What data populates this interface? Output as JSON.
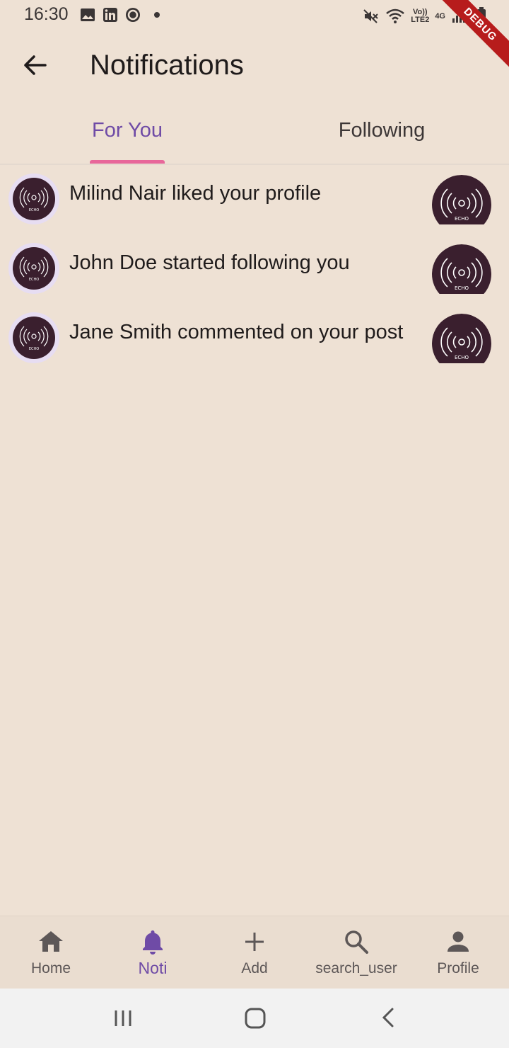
{
  "status_bar": {
    "time": "16:30",
    "icons_left": [
      "image-icon",
      "linkedin-icon",
      "record-icon",
      "dot-icon"
    ],
    "icons_right": [
      "mute-icon",
      "wifi-icon",
      "volte-icon",
      "signal-icon",
      "battery-icon"
    ],
    "volte_label_1": "Vo))",
    "volte_label_2": "LTE2",
    "network_label": "4G"
  },
  "debug_banner": "DEBUG",
  "app_bar": {
    "title": "Notifications",
    "back_icon": "arrow-left-icon"
  },
  "tabs": [
    {
      "label": "For You",
      "selected": true
    },
    {
      "label": "Following",
      "selected": false
    }
  ],
  "notifications": [
    {
      "text": "Milind Nair liked your profile"
    },
    {
      "text": "John Doe started following you"
    },
    {
      "text": "Jane Smith commented on your post"
    }
  ],
  "logo_text": "ECHO",
  "bottom_nav": [
    {
      "label": "Home",
      "icon": "home-icon",
      "active": false
    },
    {
      "label": "Noti",
      "icon": "bell-icon",
      "active": true
    },
    {
      "label": "Add",
      "icon": "plus-icon",
      "active": false
    },
    {
      "label": "search_user",
      "icon": "search-icon",
      "active": false
    },
    {
      "label": "Profile",
      "icon": "person-icon",
      "active": false
    }
  ],
  "colors": {
    "background": "#EEE1D4",
    "accent": "#6F4BA6",
    "tab_indicator": "#E8679A",
    "avatar_bg": "#3A1F2E"
  }
}
